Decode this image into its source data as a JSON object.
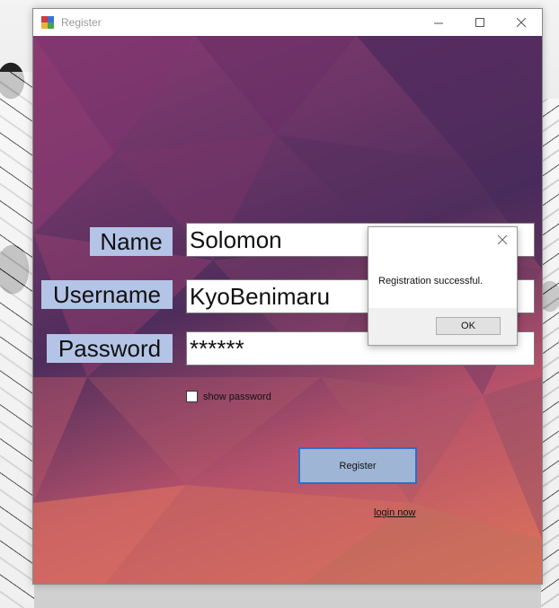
{
  "window": {
    "title": "Register"
  },
  "form": {
    "name_label": "Name",
    "username_label": "Username",
    "password_label": "Password",
    "name_value": "Solomon",
    "username_value": "KyoBenimaru",
    "password_value": "******",
    "show_password_label": "show password",
    "show_password_checked": false,
    "register_label": "Register",
    "login_link": "login now"
  },
  "message_box": {
    "text": "Registration successful.",
    "ok_label": "OK"
  },
  "colors": {
    "label_bg": "#b4c4e6",
    "register_bg": "#9fb5d6",
    "register_border": "#2f6cc8"
  }
}
